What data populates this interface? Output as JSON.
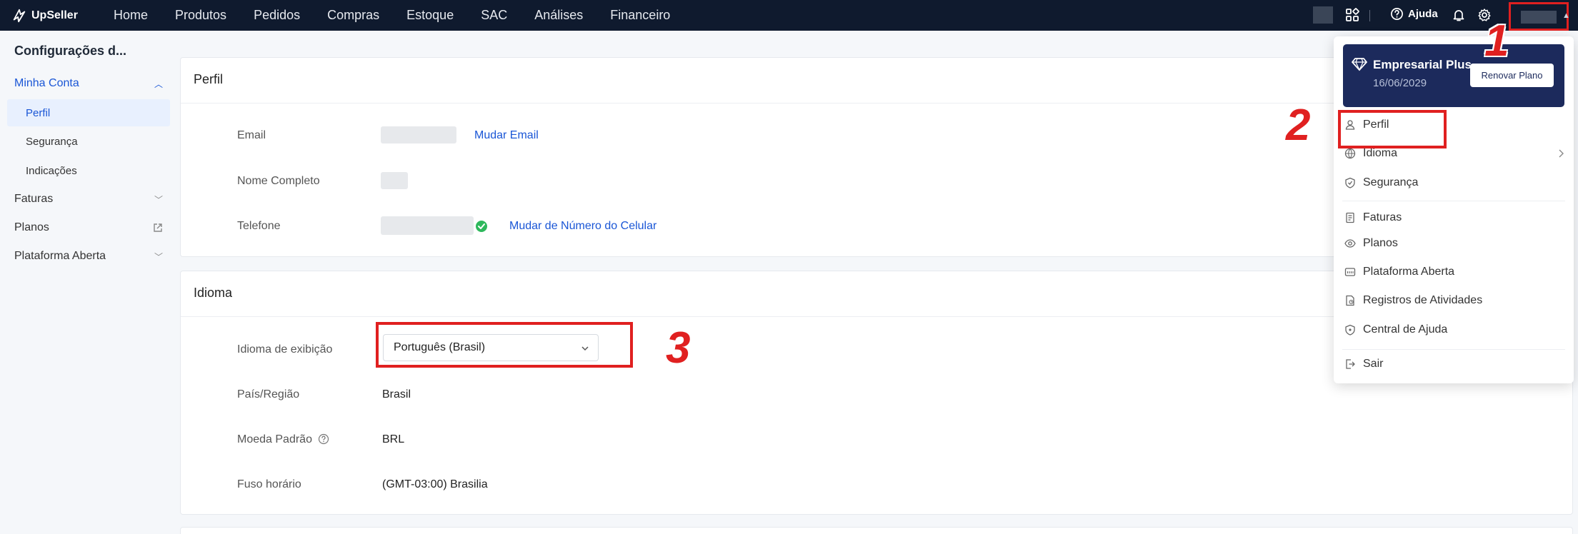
{
  "brand": {
    "name": "UpSeller"
  },
  "nav": [
    "Home",
    "Produtos",
    "Pedidos",
    "Compras",
    "Estoque",
    "SAC",
    "Análises",
    "Financeiro"
  ],
  "topbar": {
    "help_label": "Ajuda"
  },
  "sidebar": {
    "title": "Configurações d...",
    "group_account": "Minha Conta",
    "sub_items": [
      "Perfil",
      "Segurança",
      "Indicações"
    ],
    "items": [
      "Faturas",
      "Planos",
      "Plataforma Aberta"
    ]
  },
  "profile": {
    "title": "Perfil",
    "email_label": "Email",
    "change_email": "Mudar Email",
    "name_label": "Nome Completo",
    "phone_label": "Telefone",
    "change_phone": "Mudar de Número do Celular"
  },
  "language": {
    "title": "Idioma",
    "display_label": "Idioma de exibição",
    "display_value": "Português (Brasil)",
    "country_label": "País/Região",
    "country_value": "Brasil",
    "currency_label": "Moeda Padrão",
    "currency_value": "BRL",
    "timezone_label": "Fuso horário",
    "timezone_value": "(GMT-03:00) Brasilia"
  },
  "dropdown": {
    "plan_name": "Empresarial Plus",
    "plan_date": "16/06/2029",
    "renew_label": "Renovar Plano",
    "items": [
      "Perfil",
      "Idioma",
      "Segurança",
      "Faturas",
      "Planos",
      "Plataforma Aberta",
      "Registros de Atividades",
      "Central de Ajuda",
      "Sair"
    ]
  },
  "annotations": {
    "one": "1",
    "two": "2",
    "three": "3"
  },
  "colors": {
    "topbar": "#0f1a2e",
    "accent": "#1a56d6",
    "annotation": "#e02020",
    "plan_card": "#1c2a5c"
  }
}
